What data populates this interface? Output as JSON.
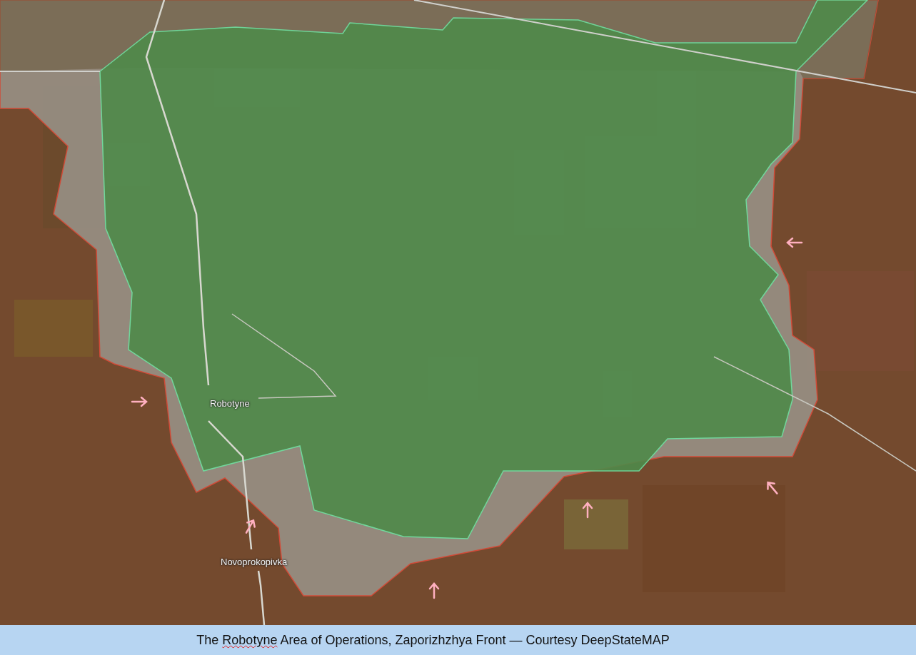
{
  "map": {
    "places": [
      {
        "name": "Robotyne"
      },
      {
        "name": "Novoprokopivka"
      }
    ]
  },
  "caption": {
    "parts": [
      {
        "text": "The ",
        "flagged": false
      },
      {
        "text": "Robotyne",
        "flagged": true
      },
      {
        "text": " Area of Operations, Zaporizhzhya Front — Courtesy DeepStateMAP",
        "flagged": false
      }
    ]
  }
}
